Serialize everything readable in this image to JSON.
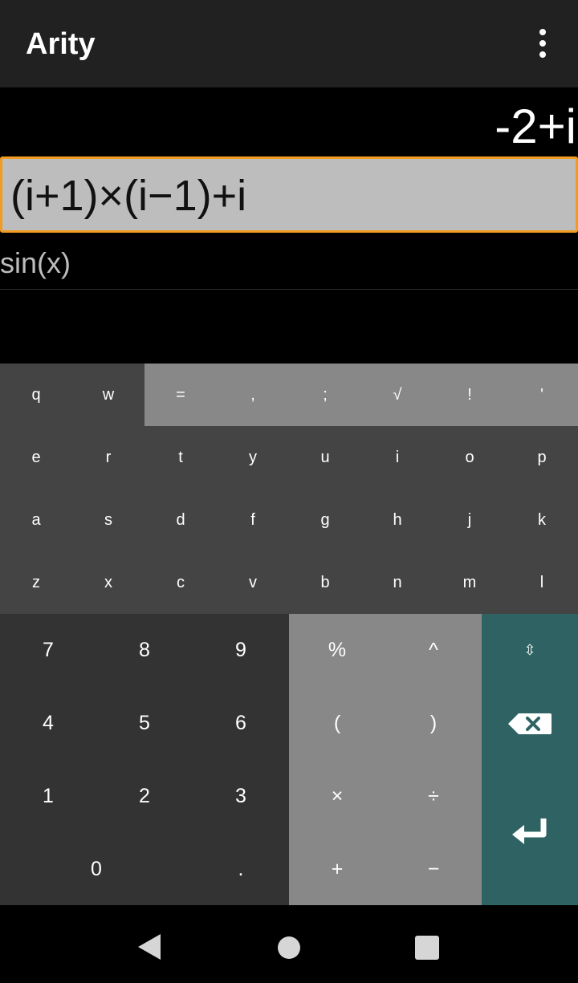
{
  "app": {
    "title": "Arity"
  },
  "result": {
    "value": "-2+i"
  },
  "input": {
    "expression": "(i+1)×(i−1)+i"
  },
  "history": {
    "items": [
      "sin(x)"
    ]
  },
  "keyboard": {
    "letter_rows": [
      [
        "q",
        "w",
        "=",
        ",",
        ";",
        "√",
        "!",
        "'"
      ],
      [
        "e",
        "r",
        "t",
        "y",
        "u",
        "i",
        "o",
        "p"
      ],
      [
        "a",
        "s",
        "d",
        "f",
        "g",
        "h",
        "j",
        "k"
      ],
      [
        "z",
        "x",
        "c",
        "v",
        "b",
        "n",
        "m",
        "l"
      ]
    ],
    "digit_rows": [
      [
        "7",
        "8",
        "9"
      ],
      [
        "4",
        "5",
        "6"
      ],
      [
        "1",
        "2",
        "3"
      ]
    ],
    "zero": "0",
    "dot": ".",
    "operator_rows": [
      [
        "%",
        "^"
      ],
      [
        "(",
        ")"
      ],
      [
        "×",
        "÷"
      ],
      [
        "+",
        "−"
      ]
    ],
    "shift_symbol": "⇳"
  },
  "icons": {
    "overflow": "more-vert-icon",
    "backspace": "backspace-icon",
    "enter": "enter-icon",
    "nav_back": "back-triangle-icon",
    "nav_home": "home-circle-icon",
    "nav_recents": "recents-square-icon"
  },
  "colors": {
    "appbar": "#212121",
    "input_border": "#f39a20",
    "input_bg": "#bdbdbd",
    "letter_keys_bg": "#444444",
    "symbol_keys_bg": "#888888",
    "numpad_bg": "#333333",
    "action_keys_bg": "#2f6363"
  }
}
